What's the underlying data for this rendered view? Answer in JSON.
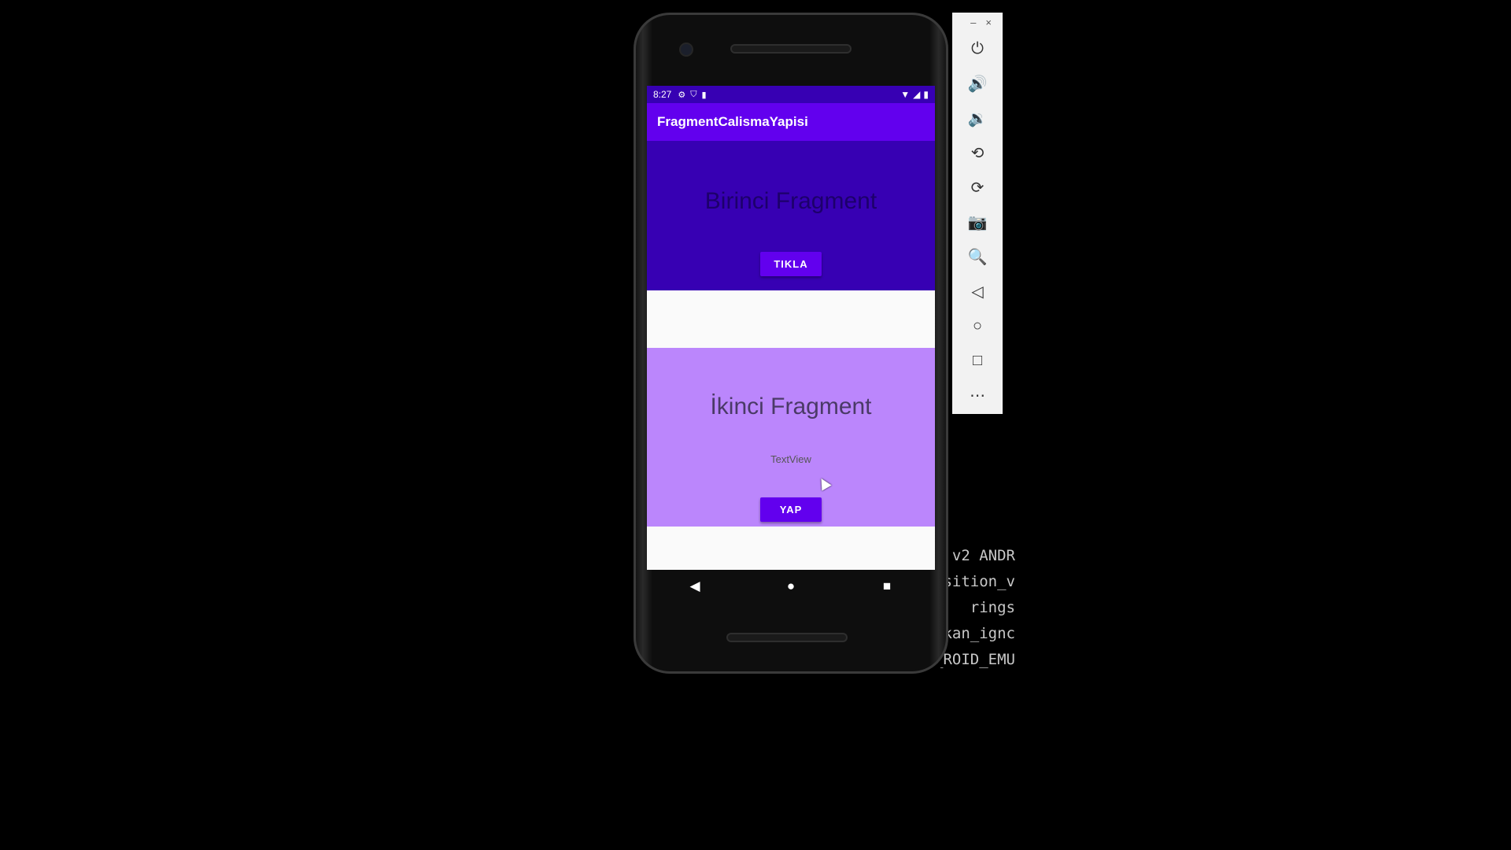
{
  "status_bar": {
    "time": "8:27",
    "icons_left": [
      "gear-icon",
      "shield-icon",
      "sdcard-icon"
    ],
    "icons_right": [
      "wifi-icon",
      "signal-icon",
      "battery-icon"
    ]
  },
  "app_bar": {
    "title": "FragmentCalismaYapisi"
  },
  "fragment1": {
    "title": "Birinci Fragment",
    "button_label": "TIKLA",
    "background": "#3700b3"
  },
  "fragment2": {
    "title": "İkinci Fragment",
    "textview": "TextView",
    "button_label": "YAP",
    "background": "#bb86fc"
  },
  "nav_bar": {
    "back": "◀",
    "home": "●",
    "recents": "■"
  },
  "tool_panel": {
    "minimize": "–",
    "close": "×",
    "tools": [
      "power-icon",
      "volume-up-icon",
      "volume-down-icon",
      "rotate-left-icon",
      "rotate-right-icon",
      "camera-icon",
      "zoom-icon",
      "back-icon",
      "home-icon",
      "overview-icon",
      "more-icon"
    ]
  },
  "terminal_lines": [
    "v2 ANDR",
    "sition_v",
    "rings",
    "kan_ignc",
    "ROID_EMU_"
  ],
  "colors": {
    "primary": "#6200ee",
    "primary_dark": "#3700b3",
    "accent_light": "#bb86fc"
  }
}
